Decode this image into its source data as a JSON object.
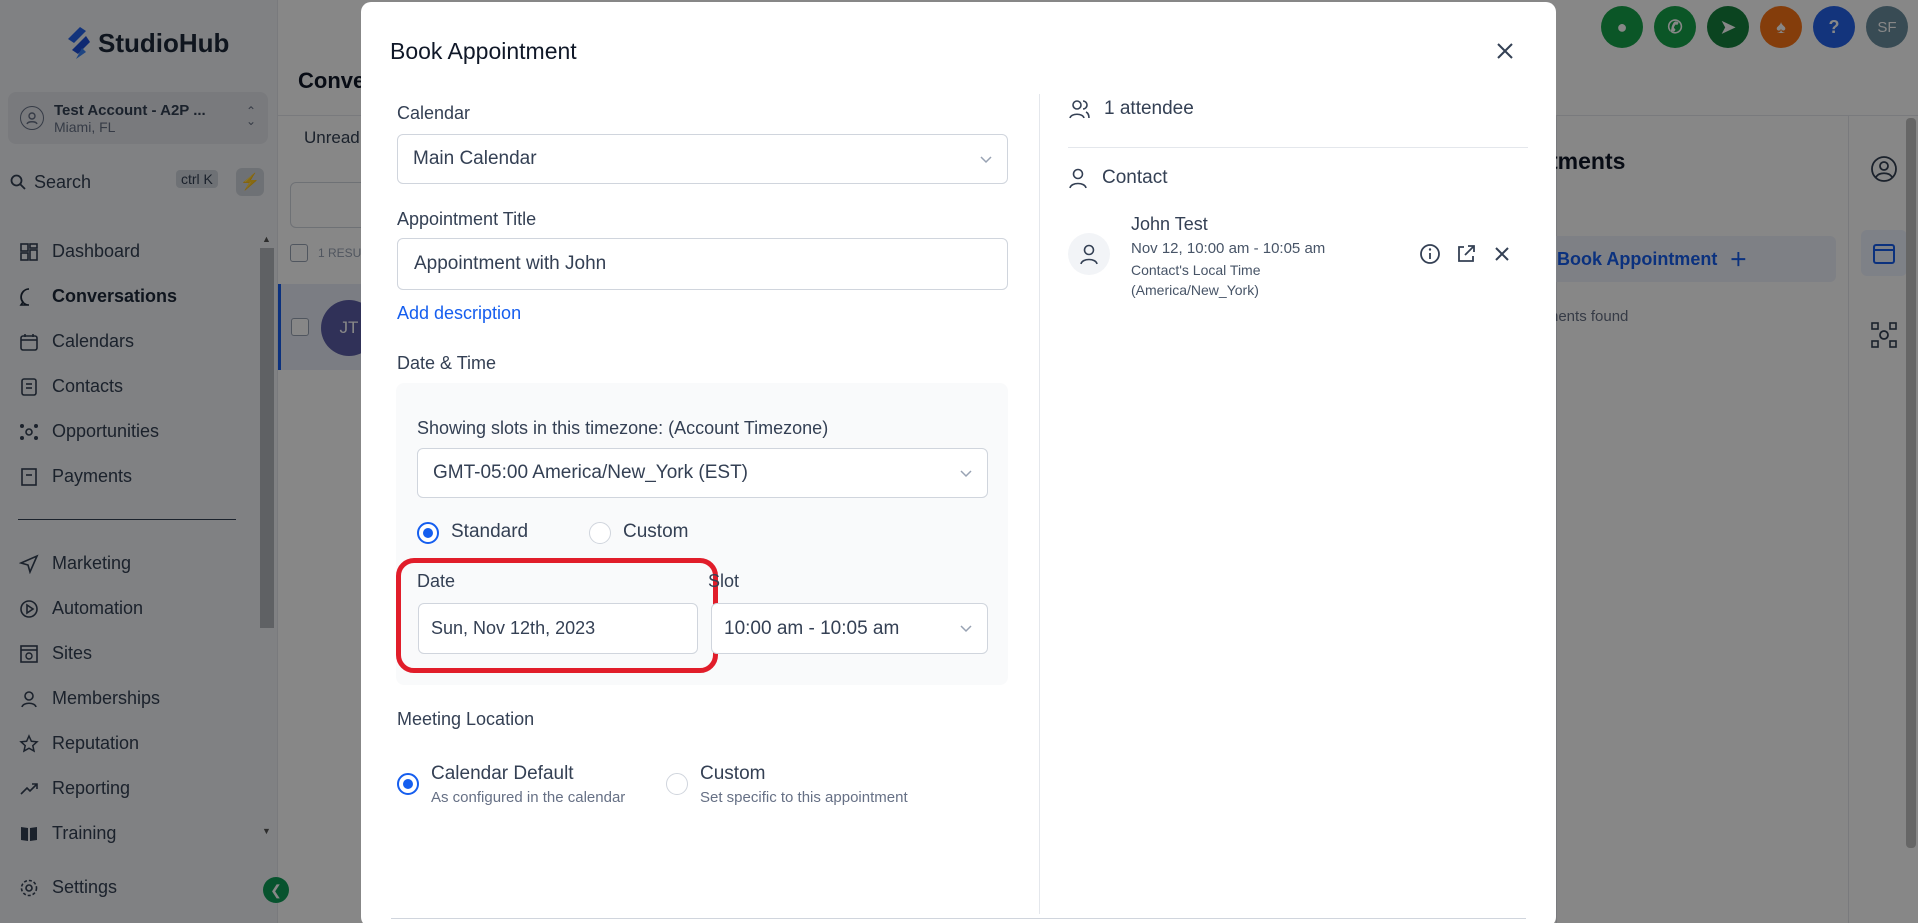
{
  "app": {
    "brand": "StudioHub"
  },
  "account": {
    "name": "Test Account - A2P ...",
    "location": "Miami, FL"
  },
  "search": {
    "label": "Search",
    "shortcut": "ctrl K"
  },
  "nav": {
    "primary": [
      {
        "label": "Dashboard",
        "icon": "dashboard-icon"
      },
      {
        "label": "Conversations",
        "icon": "chat-icon",
        "active": true
      },
      {
        "label": "Calendars",
        "icon": "calendar-icon"
      },
      {
        "label": "Contacts",
        "icon": "contacts-icon"
      },
      {
        "label": "Opportunities",
        "icon": "opportunities-icon"
      },
      {
        "label": "Payments",
        "icon": "payments-icon"
      }
    ],
    "secondary": [
      {
        "label": "Marketing",
        "icon": "send-icon"
      },
      {
        "label": "Automation",
        "icon": "automation-icon"
      },
      {
        "label": "Sites",
        "icon": "sites-icon"
      },
      {
        "label": "Memberships",
        "icon": "memberships-icon"
      },
      {
        "label": "Reputation",
        "icon": "star-icon"
      },
      {
        "label": "Reporting",
        "icon": "trend-icon"
      },
      {
        "label": "Training",
        "icon": "book-icon"
      }
    ],
    "settings": "Settings"
  },
  "background": {
    "page_title": "Conve",
    "tab_unread": "Unread",
    "results": "1 RESU",
    "avatar_initials": "JT",
    "right_title": "tments",
    "right_button": "Book Appointment",
    "right_empty": "nents found",
    "top_avatar": "SF"
  },
  "modal": {
    "title": "Book Appointment",
    "calendar_label": "Calendar",
    "calendar_value": "Main Calendar",
    "title_label": "Appointment Title",
    "title_value": "Appointment with John",
    "add_description": "Add description",
    "datetime_label": "Date & Time",
    "timezone_label": "Showing slots in this timezone: (Account Timezone)",
    "timezone_value": "GMT-05:00 America/New_York (EST)",
    "slot_type": {
      "standard": "Standard",
      "custom": "Custom",
      "selected": "Standard"
    },
    "date_label": "Date",
    "date_value": "Sun, Nov 12th, 2023",
    "slot_label": "Slot",
    "slot_value": "10:00 am - 10:05 am",
    "location_label": "Meeting Location",
    "location_options": {
      "default_title": "Calendar Default",
      "default_sub": "As configured in the calendar",
      "custom_title": "Custom",
      "custom_sub": "Set specific to this appointment",
      "selected": "Calendar Default"
    },
    "attendees": "1 attendee",
    "contact_header": "Contact",
    "contact": {
      "name": "John Test",
      "time": "Nov 12, 10:00 am - 10:05 am",
      "local_time": "Contact's Local Time (America/New_York)"
    }
  },
  "colors": {
    "accent": "#155eef",
    "highlight": "#e11d2a",
    "top_icons": [
      "#16a34a",
      "#16a34a",
      "#15803d",
      "#f97316",
      "#2563eb",
      "#6b8e9f"
    ]
  }
}
